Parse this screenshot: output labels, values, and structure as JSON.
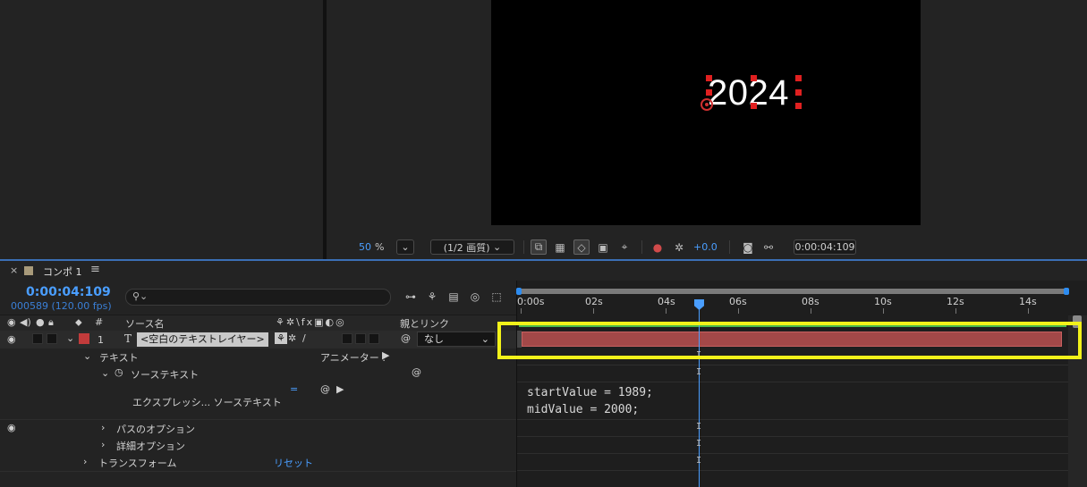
{
  "viewer": {
    "canvas_text": "2024",
    "zoom": "50",
    "zoom_unit": "%",
    "resolution": "(1/2 画質)",
    "exposure": "+0.0",
    "timecode": "0:00:04:109"
  },
  "timeline": {
    "close": "×",
    "title": "コンポ 1",
    "menu": "≡",
    "timecode": "0:00:04:109",
    "frames": "000589 (120.00 fps)",
    "col_number": "#",
    "col_source": "ソース名",
    "col_parent": "親とリンク",
    "layer": {
      "index": "1",
      "type_icon": "T",
      "name": "<空白のテキストレイヤー>",
      "parent": "なし"
    },
    "rows": {
      "text": "テキスト",
      "animator": "アニメーター :",
      "source_text": "ソーステキスト",
      "expression": "エクスプレッシ... ソーステキスト",
      "path_options": "パスのオプション",
      "more_options": "詳細オプション",
      "transform": "トランスフォーム",
      "reset": "リセット"
    },
    "ruler": [
      "0:00s",
      "02s",
      "04s",
      "06s",
      "08s",
      "10s",
      "12s",
      "14s"
    ],
    "expression_code": "startValue = 1989;\nmidValue = 2000;"
  },
  "colors": {
    "accent_blue": "#4a9eff",
    "layer_bar": "#a34848",
    "highlight": "#f2f21a",
    "label_red": "#c23b3b"
  }
}
